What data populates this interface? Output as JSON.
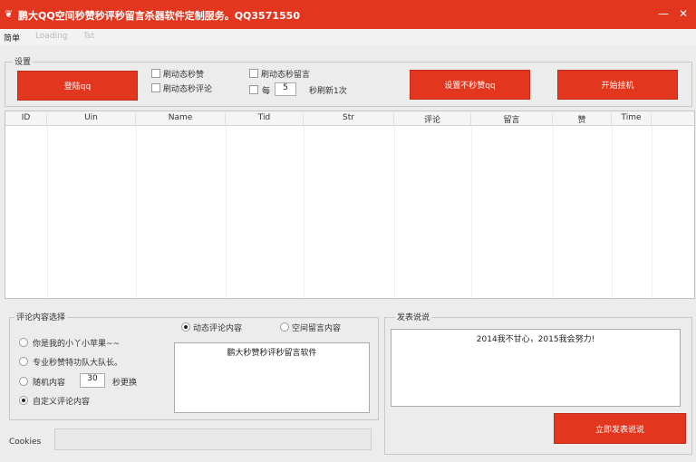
{
  "window": {
    "title": "鹏大QQ空间秒赞秒评秒留言杀器软件定制服务。QQ3571550",
    "minimize": "—",
    "close": "✕"
  },
  "menu": [
    "简单",
    "Loading",
    "Tst"
  ],
  "settings": {
    "legend": "设置",
    "login_button": "登陆qq",
    "auto_like_label": "刷动态秒赞",
    "auto_comment_label": "刷动态秒评论",
    "auto_msg_label": "刷动态秒留言",
    "every_label": "每",
    "interval_value": "5",
    "interval_suffix": "秒刷新1次",
    "no_like_button": "设置不秒赞qq",
    "start_button": "开始挂机"
  },
  "table": {
    "columns": [
      "ID",
      "Uin",
      "Name",
      "Tid",
      "Str",
      "评论",
      "留言",
      "赞",
      "Time"
    ],
    "rows": []
  },
  "comment_panel": {
    "legend": "评论内容选择",
    "options": [
      {
        "label": "你是我的小丫小苹果~~",
        "selected": false
      },
      {
        "label": "专业秒赞特功队大队长。",
        "selected": false
      },
      {
        "label": "随机内容",
        "selected": false
      },
      {
        "label": "自定义评论内容",
        "selected": true
      }
    ],
    "random_seconds": "30",
    "random_suffix": "秒更换",
    "dynamic_comment_label": "动态评论内容",
    "space_msg_label": "空间留言内容",
    "content_text": "鹏大秒赞秒评秒留言软件"
  },
  "publish_panel": {
    "legend": "发表说说",
    "content_text": "2014我不甘心，2015我会努力!",
    "publish_button": "立即发表说说"
  },
  "cookies_label": "Cookies",
  "colors": {
    "accent": "#e2361f",
    "background": "#ececec"
  }
}
